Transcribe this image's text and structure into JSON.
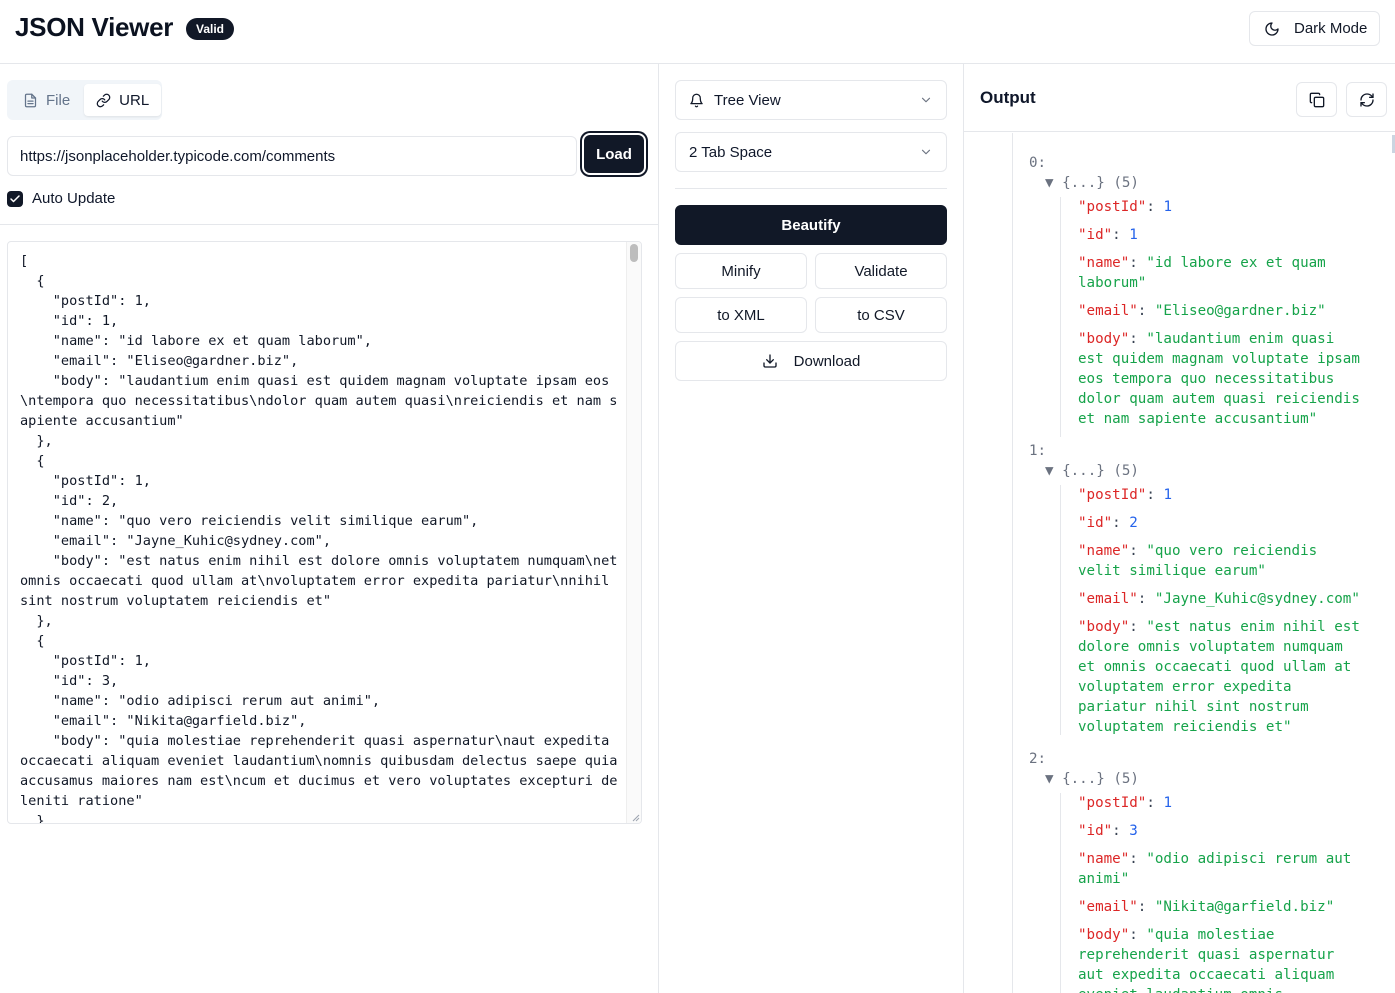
{
  "header": {
    "title": "JSON Viewer",
    "badge": "Valid",
    "dark_mode_label": "Dark Mode"
  },
  "input": {
    "tabs": [
      {
        "label": "File",
        "icon": "file-icon",
        "active": false
      },
      {
        "label": "URL",
        "icon": "link-icon",
        "active": true
      }
    ],
    "url_value": "https://jsonplaceholder.typicode.com/comments",
    "load_label": "Load",
    "auto_update_label": "Auto Update",
    "auto_update_checked": true,
    "editor_text": "[\n  {\n    \"postId\": 1,\n    \"id\": 1,\n    \"name\": \"id labore ex et quam laborum\",\n    \"email\": \"Eliseo@gardner.biz\",\n    \"body\": \"laudantium enim quasi est quidem magnam voluptate ipsam eos\\ntempora quo necessitatibus\\ndolor quam autem quasi\\nreiciendis et nam sapiente accusantium\"\n  },\n  {\n    \"postId\": 1,\n    \"id\": 2,\n    \"name\": \"quo vero reiciendis velit similique earum\",\n    \"email\": \"Jayne_Kuhic@sydney.com\",\n    \"body\": \"est natus enim nihil est dolore omnis voluptatem numquam\\net omnis occaecati quod ullam at\\nvoluptatem error expedita pariatur\\nnihil sint nostrum voluptatem reiciendis et\"\n  },\n  {\n    \"postId\": 1,\n    \"id\": 3,\n    \"name\": \"odio adipisci rerum aut animi\",\n    \"email\": \"Nikita@garfield.biz\",\n    \"body\": \"quia molestiae reprehenderit quasi aspernatur\\naut expedita occaecati aliquam eveniet laudantium\\nomnis quibusdam delectus saepe quia accusamus maiores nam est\\ncum et ducimus et vero voluptates excepturi deleniti ratione\"\n  },"
  },
  "controls": {
    "view_select": "Tree View",
    "indent_select": "2 Tab Space",
    "beautify": "Beautify",
    "minify": "Minify",
    "validate": "Validate",
    "to_xml": "to XML",
    "to_csv": "to CSV",
    "download": "Download"
  },
  "output": {
    "title": "Output",
    "nodes": [
      {
        "index": "0:",
        "summary": "▼ {...} (5)",
        "props": [
          {
            "key": "\"postId\"",
            "value": "1",
            "type": "number"
          },
          {
            "key": "\"id\"",
            "value": "1",
            "type": "number"
          },
          {
            "key": "\"name\"",
            "value": "\"id labore ex et quam laborum\"",
            "type": "string"
          },
          {
            "key": "\"email\"",
            "value": "\"Eliseo@gardner.biz\"",
            "type": "string"
          },
          {
            "key": "\"body\"",
            "value": "\"laudantium enim quasi est quidem magnam voluptate ipsam eos tempora quo necessitatibus dolor quam autem quasi reiciendis et nam sapiente accusantium\"",
            "type": "string"
          }
        ]
      },
      {
        "index": "1:",
        "summary": "▼ {...} (5)",
        "props": [
          {
            "key": "\"postId\"",
            "value": "1",
            "type": "number"
          },
          {
            "key": "\"id\"",
            "value": "2",
            "type": "number"
          },
          {
            "key": "\"name\"",
            "value": "\"quo vero reiciendis velit similique earum\"",
            "type": "string"
          },
          {
            "key": "\"email\"",
            "value": "\"Jayne_Kuhic@sydney.com\"",
            "type": "string"
          },
          {
            "key": "\"body\"",
            "value": "\"est natus enim nihil est dolore omnis voluptatem numquam et omnis occaecati quod ullam at voluptatem error expedita pariatur nihil sint nostrum voluptatem reiciendis et\"",
            "type": "string"
          }
        ]
      },
      {
        "index": "2:",
        "summary": "▼ {...} (5)",
        "props": [
          {
            "key": "\"postId\"",
            "value": "1",
            "type": "number"
          },
          {
            "key": "\"id\"",
            "value": "3",
            "type": "number"
          },
          {
            "key": "\"name\"",
            "value": "\"odio adipisci rerum aut animi\"",
            "type": "string"
          },
          {
            "key": "\"email\"",
            "value": "\"Nikita@garfield.biz\"",
            "type": "string"
          },
          {
            "key": "\"body\"",
            "value": "\"quia molestiae reprehenderit quasi aspernatur aut expedita occaecati aliquam eveniet laudantium omnis quibusdam delectus\"",
            "type": "string"
          }
        ]
      }
    ]
  },
  "colors": {
    "primary": "#111827",
    "key": "#dc2626",
    "number": "#2563eb",
    "string": "#16a34a",
    "border": "#e5e7eb"
  }
}
